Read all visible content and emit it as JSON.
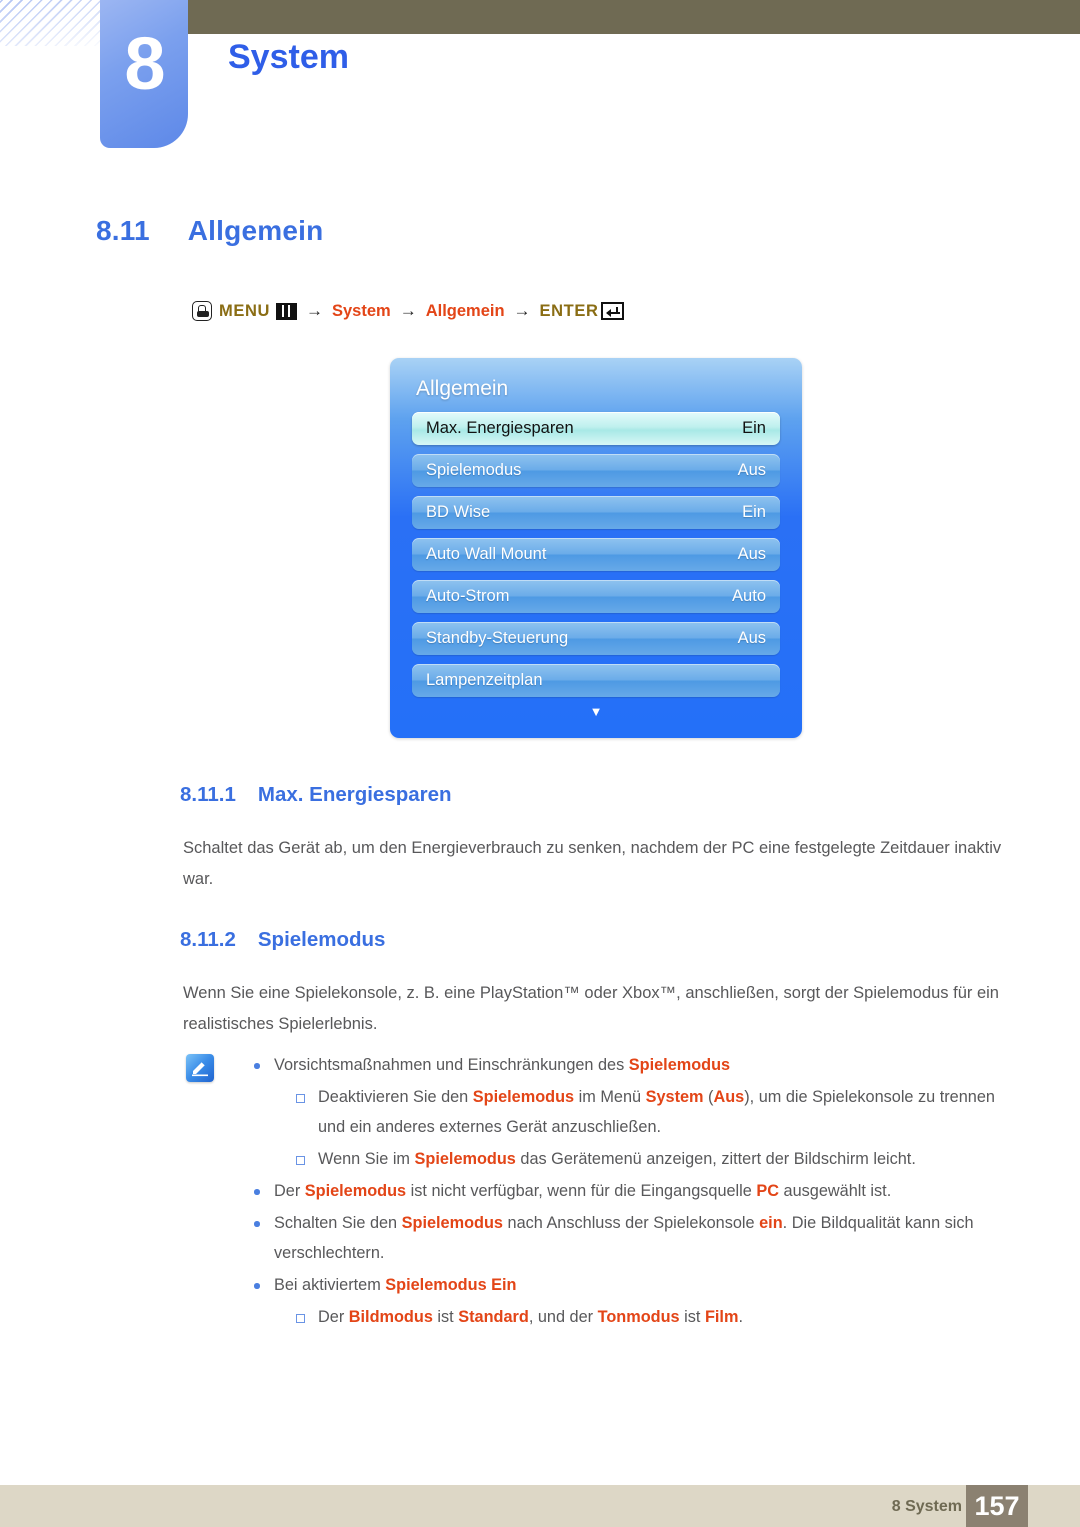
{
  "header": {
    "chapter_number": "8",
    "chapter_title": "System"
  },
  "section": {
    "number": "8.11",
    "title": "Allgemein"
  },
  "nav_path": {
    "hand_icon": "hand-press-icon",
    "menu_label": "MENU",
    "menu_icon": "menu-button-icon",
    "arrow1": "→",
    "step1": "System",
    "arrow2": "→",
    "step2": "Allgemein",
    "arrow3": "→",
    "enter_label": "ENTER",
    "enter_icon": "enter-key-icon"
  },
  "osd": {
    "title": "Allgemein",
    "rows": [
      {
        "label": "Max. Energiesparen",
        "value": "Ein",
        "selected": true
      },
      {
        "label": "Spielemodus",
        "value": "Aus",
        "selected": false
      },
      {
        "label": "BD Wise",
        "value": "Ein",
        "selected": false
      },
      {
        "label": "Auto Wall Mount",
        "value": "Aus",
        "selected": false
      },
      {
        "label": "Auto-Strom",
        "value": "Auto",
        "selected": false
      },
      {
        "label": "Standby-Steuerung",
        "value": "Aus",
        "selected": false
      },
      {
        "label": "Lampenzeitplan",
        "value": "",
        "selected": false
      }
    ],
    "scroll_down_icon": "chevron-down-icon"
  },
  "subsections": [
    {
      "number": "8.11.1",
      "title": "Max. Energiesparen",
      "body": "Schaltet das Gerät ab, um den Energieverbrauch zu senken, nachdem der PC eine festgelegte Zeitdauer inaktiv war."
    },
    {
      "number": "8.11.2",
      "title": "Spielemodus",
      "body": "Wenn Sie eine Spielekonsole, z. B. eine PlayStation™ oder Xbox™, anschließen, sorgt der Spielemodus für ein realistisches Spielerlebnis."
    }
  ],
  "note": {
    "icon": "note-pen-icon",
    "items": [
      {
        "level": 1,
        "parts": [
          {
            "t": "Vorsichtsmaßnahmen und Einschränkungen des ",
            "hl": false
          },
          {
            "t": "Spielemodus",
            "hl": true
          }
        ]
      },
      {
        "level": 2,
        "parts": [
          {
            "t": "Deaktivieren Sie den ",
            "hl": false
          },
          {
            "t": "Spielemodus",
            "hl": true
          },
          {
            "t": " im Menü ",
            "hl": false
          },
          {
            "t": "System",
            "hl": true
          },
          {
            "t": " (",
            "hl": false
          },
          {
            "t": "Aus",
            "hl": true
          },
          {
            "t": "), um die Spielekonsole zu trennen und ein anderes externes Gerät anzuschließen.",
            "hl": false
          }
        ]
      },
      {
        "level": 2,
        "parts": [
          {
            "t": "Wenn Sie im ",
            "hl": false
          },
          {
            "t": "Spielemodus",
            "hl": true
          },
          {
            "t": " das Gerätemenü anzeigen, zittert der Bildschirm leicht.",
            "hl": false
          }
        ]
      },
      {
        "level": 1,
        "parts": [
          {
            "t": "Der ",
            "hl": false
          },
          {
            "t": "Spielemodus",
            "hl": true
          },
          {
            "t": " ist nicht verfügbar, wenn für die Eingangsquelle ",
            "hl": false
          },
          {
            "t": "PC",
            "hl": true
          },
          {
            "t": " ausgewählt ist.",
            "hl": false
          }
        ]
      },
      {
        "level": 1,
        "parts": [
          {
            "t": "Schalten Sie den ",
            "hl": false
          },
          {
            "t": "Spielemodus",
            "hl": true
          },
          {
            "t": " nach Anschluss der Spielekonsole ",
            "hl": false
          },
          {
            "t": "ein",
            "hl": true
          },
          {
            "t": ". Die Bildqualität kann sich verschlechtern.",
            "hl": false
          }
        ]
      },
      {
        "level": 1,
        "parts": [
          {
            "t": "Bei aktiviertem ",
            "hl": false
          },
          {
            "t": "Spielemodus Ein",
            "hl": true
          }
        ]
      },
      {
        "level": 2,
        "parts": [
          {
            "t": "Der ",
            "hl": false
          },
          {
            "t": "Bildmodus",
            "hl": true
          },
          {
            "t": " ist ",
            "hl": false
          },
          {
            "t": "Standard",
            "hl": true
          },
          {
            "t": ", und der ",
            "hl": false
          },
          {
            "t": "Tonmodus",
            "hl": true
          },
          {
            "t": " ist ",
            "hl": false
          },
          {
            "t": "Film",
            "hl": true
          },
          {
            "t": ".",
            "hl": false
          }
        ]
      }
    ]
  },
  "footer": {
    "label": "8 System",
    "page_number": "157"
  },
  "colors": {
    "heading_blue": "#3a6fe0",
    "title_blue": "#2f5ee8",
    "highlight_red": "#e34517",
    "nav_gold": "#8a6d14",
    "khaki": "#6f6a53",
    "footer_bg": "#ddd7c6",
    "page_box": "#8b8171",
    "body_gray": "#58585a"
  }
}
